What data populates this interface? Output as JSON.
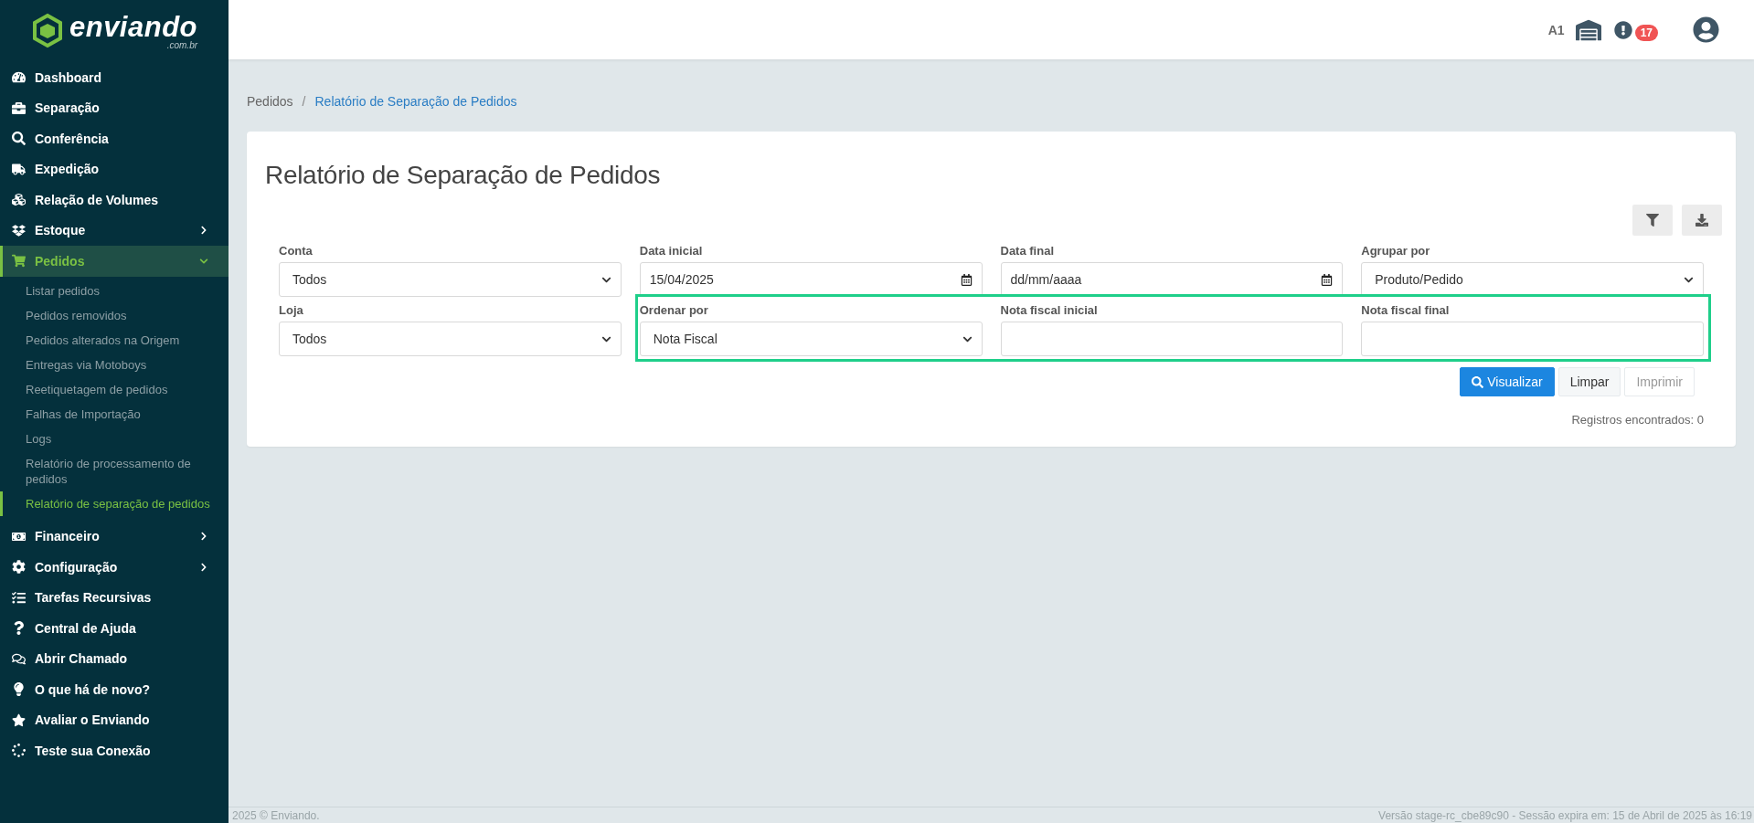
{
  "logo": {
    "name": "enviando",
    "suffix": ".com.br"
  },
  "sidebar": {
    "items": [
      {
        "label": "Dashboard",
        "selected": false
      },
      {
        "label": "Separação",
        "selected": false
      },
      {
        "label": "Conferência",
        "selected": false
      },
      {
        "label": "Expedição",
        "selected": false
      },
      {
        "label": "Relação de Volumes",
        "selected": false
      },
      {
        "label": "Estoque",
        "selected": false,
        "expanded": false
      },
      {
        "label": "Pedidos",
        "selected": true,
        "expanded": true,
        "children": [
          {
            "label": "Listar pedidos",
            "selected": false
          },
          {
            "label": "Pedidos removidos",
            "selected": false
          },
          {
            "label": "Pedidos alterados na Origem",
            "selected": false
          },
          {
            "label": "Entregas via Motoboys",
            "selected": false
          },
          {
            "label": "Reetiquetagem de pedidos",
            "selected": false
          },
          {
            "label": "Falhas de Importação",
            "selected": false
          },
          {
            "label": "Logs",
            "selected": false
          },
          {
            "label": "Relatório de processamento de pedidos",
            "selected": false
          },
          {
            "label": "Relatório de separação de pedidos",
            "selected": true
          }
        ]
      },
      {
        "label": "Financeiro",
        "selected": false,
        "expanded": false
      },
      {
        "label": "Configuração",
        "selected": false,
        "expanded": false
      },
      {
        "label": "Tarefas Recursivas",
        "selected": false
      },
      {
        "label": "Central de Ajuda",
        "selected": false
      },
      {
        "label": "Abrir Chamado",
        "selected": false
      },
      {
        "label": "O que há de novo?",
        "selected": false
      },
      {
        "label": "Avaliar o Enviando",
        "selected": false
      },
      {
        "label": "Teste sua Conexão",
        "selected": false
      }
    ]
  },
  "header": {
    "account": "A1",
    "notification_count": "17"
  },
  "breadcrumb": {
    "separator": "/",
    "items": [
      "Pedidos",
      "Relatório de Separação de Pedidos"
    ]
  },
  "page": {
    "title": "Relatório de Separação de Pedidos",
    "form": {
      "rows": [
        [
          {
            "label": "Conta",
            "kind": "select",
            "value": "Todos"
          },
          {
            "label": "Data inicial",
            "kind": "date",
            "value": "15/04/2025"
          },
          {
            "label": "Data final",
            "kind": "date",
            "placeholder": "dd/mm/aaaa"
          },
          {
            "label": "Agrupar por",
            "kind": "select",
            "value": "Produto/Pedido"
          }
        ],
        [
          {
            "label": "Loja",
            "kind": "select",
            "value": "Todos"
          },
          {
            "label": "Ordenar por",
            "kind": "select",
            "value": "Nota Fiscal",
            "highlighted": true
          },
          {
            "label": "Nota fiscal inicial",
            "kind": "text",
            "highlighted": true
          },
          {
            "label": "Nota fiscal final",
            "kind": "text",
            "highlighted": true
          }
        ]
      ]
    },
    "buttons": [
      {
        "label": "Visualizar",
        "kind": "primary",
        "disabled": false
      },
      {
        "label": "Limpar",
        "kind": "default",
        "disabled": false
      },
      {
        "label": "Imprimir",
        "kind": "default",
        "disabled": true
      }
    ],
    "records": "Registros encontrados: 0"
  },
  "footer": {
    "copyright": "2025 © Enviando.",
    "version": "Versão stage-rc_cbe89c90 - Sessão expira em: 15 de Abril de 2025 às 16:19"
  }
}
